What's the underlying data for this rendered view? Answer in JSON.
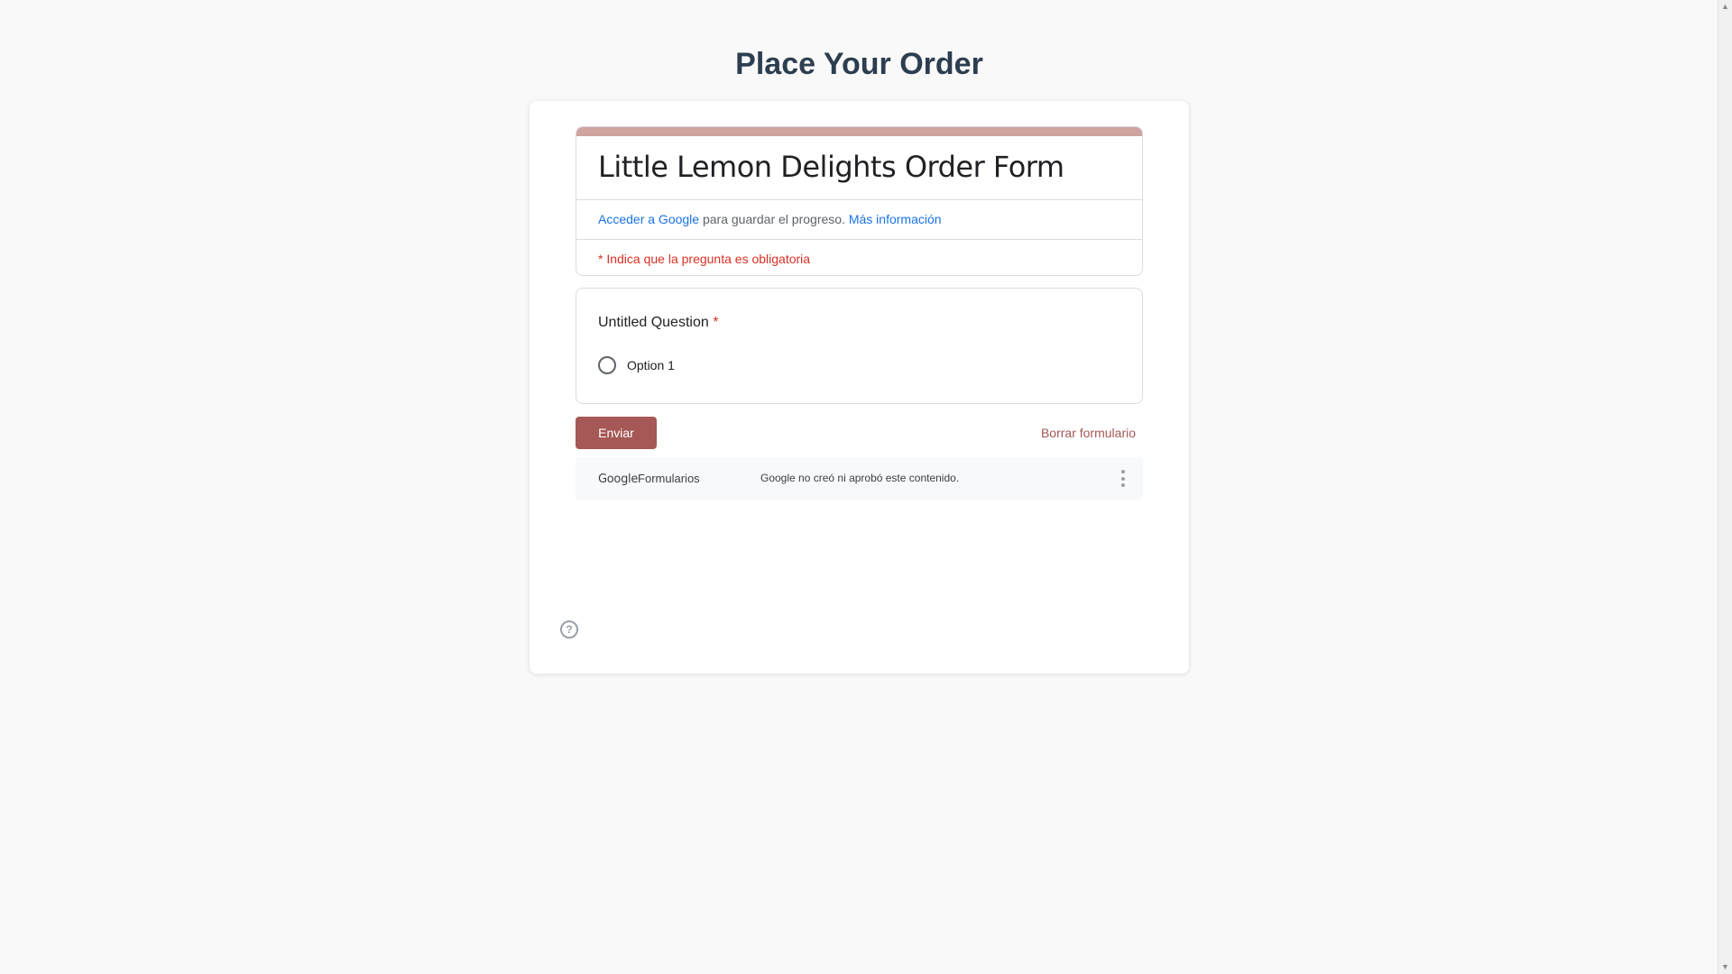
{
  "page": {
    "title": "Place Your Order"
  },
  "form": {
    "title": "Little Lemon Delights Order Form",
    "signin_link": "Acceder a Google",
    "signin_text": " para guardar el progreso. ",
    "more_info_link": "Más información",
    "required_note": "* Indica que la pregunta es obligatoria",
    "accent_color": "#cfa3a0",
    "button_color": "#a55855"
  },
  "question": {
    "title": "Untitled Question",
    "required_mark": "*",
    "options": [
      {
        "label": "Option 1"
      }
    ]
  },
  "actions": {
    "submit_label": "Enviar",
    "clear_label": "Borrar formulario"
  },
  "footer": {
    "logo_google": "Google",
    "logo_forms": "Formularios",
    "disclaimer": "Google no creó ni aprobó este contenido."
  },
  "icons": {
    "help": "help-icon",
    "more": "more-vertical-icon",
    "radio": "radio-unchecked-icon"
  }
}
